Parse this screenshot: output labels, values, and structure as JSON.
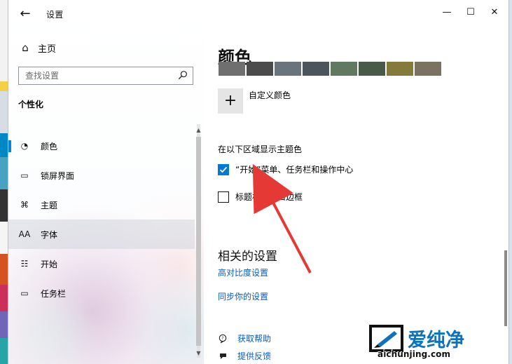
{
  "window": {
    "title": "设置",
    "controls": {
      "minimize": "—",
      "maximize": "☐",
      "close": "✕"
    }
  },
  "sidebar": {
    "home_label": "主页",
    "search_placeholder": "查找设置",
    "section_label": "个性化",
    "items": [
      {
        "label": "颜色",
        "icon": "palette-icon",
        "glyph": "◔",
        "selected": false,
        "active": true
      },
      {
        "label": "锁屏界面",
        "icon": "lock-screen-icon",
        "glyph": "▭",
        "selected": false,
        "active": false
      },
      {
        "label": "主题",
        "icon": "theme-icon",
        "glyph": "⌘",
        "selected": false,
        "active": false
      },
      {
        "label": "字体",
        "icon": "font-icon",
        "glyph": "AA",
        "selected": true,
        "active": false
      },
      {
        "label": "开始",
        "icon": "start-icon",
        "glyph": "☷",
        "selected": false,
        "active": false
      },
      {
        "label": "任务栏",
        "icon": "taskbar-icon",
        "glyph": "▭",
        "selected": false,
        "active": false
      }
    ]
  },
  "main": {
    "title": "颜色",
    "swatch_colors": [
      "#6f6f6f",
      "#4b4b4b",
      "#69747d",
      "#4c545c",
      "#607960",
      "#4a5a48",
      "#847b3a",
      "#7b725f"
    ],
    "custom_color_label": "自定义颜色",
    "accent_surfaces_label": "在以下区域显示主题色",
    "start_taskbar_action_center": "“开始”菜单、任务栏和操作中心",
    "title_bars_window_borders": "标题栏和窗口边框",
    "start_taskbar_checked": true,
    "title_bars_checked": false,
    "related_settings": "相关的设置",
    "links": {
      "high_contrast": "高对比度设置",
      "sync": "同步你的设置"
    },
    "help": {
      "get_help": "获取帮助",
      "feedback": "提供反馈"
    }
  },
  "watermark": {
    "main": "爱纯净",
    "url": "aichunjing.com"
  },
  "colors": {
    "accent": "#0078d4",
    "link": "#0b5dbb",
    "annotation": "#e53935",
    "watermark": "#0e73ba"
  }
}
